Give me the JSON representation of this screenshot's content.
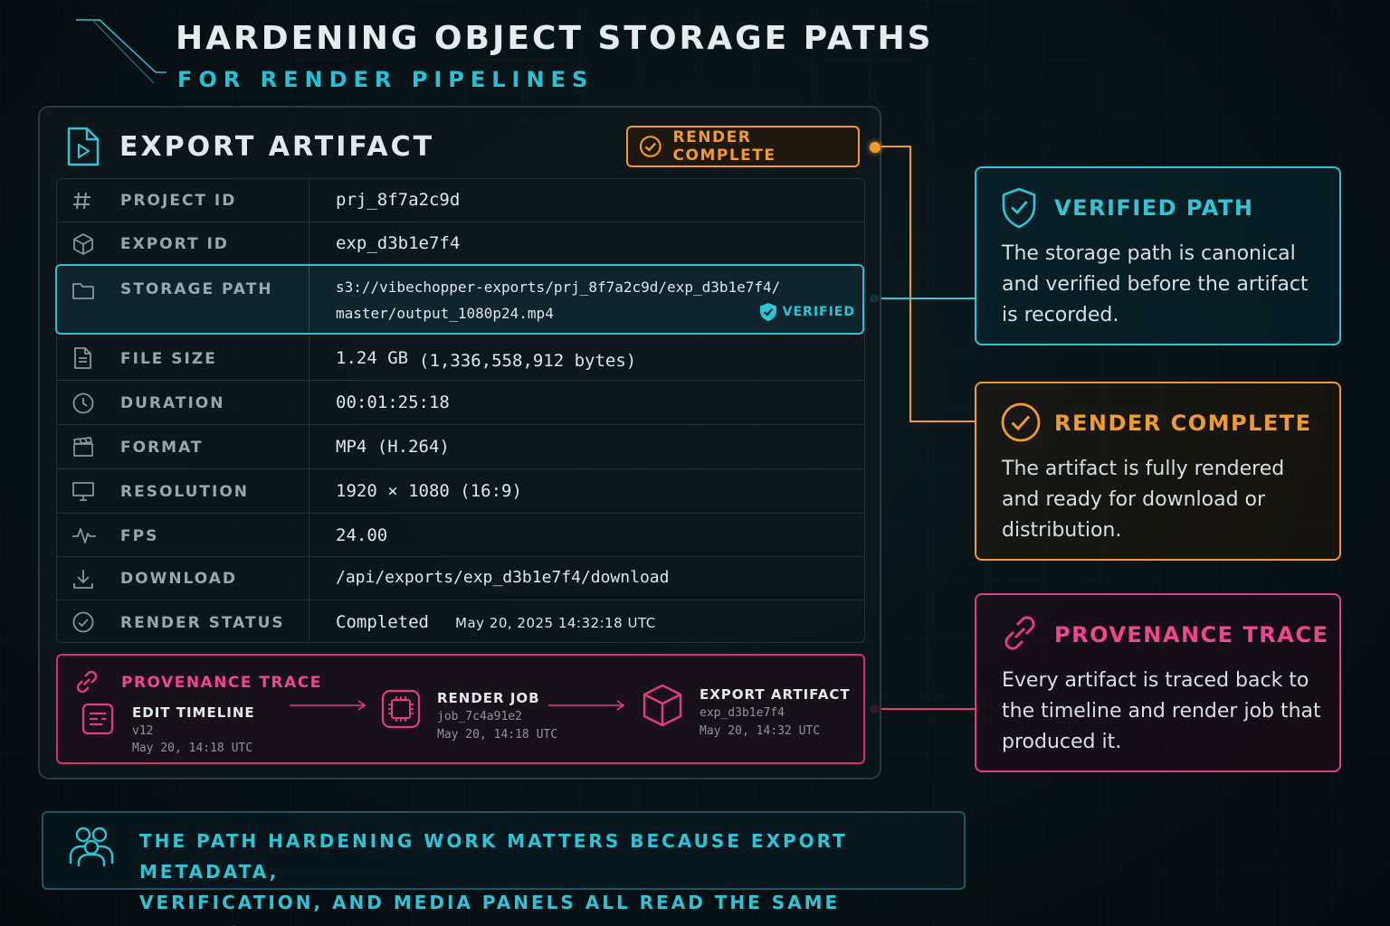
{
  "header": {
    "title": "HARDENING OBJECT STORAGE PATHS",
    "subtitle": "FOR RENDER PIPELINES"
  },
  "panel": {
    "title": "EXPORT ARTIFACT",
    "title_icon": "file-play-icon",
    "status_badge": "RENDER COMPLETE",
    "rows": [
      {
        "icon": "hash-icon",
        "label": "PROJECT ID",
        "value": "prj_8f7a2c9d"
      },
      {
        "icon": "cube-icon",
        "label": "EXPORT ID",
        "value": "exp_d3b1e7f4"
      },
      {
        "icon": "folder-icon",
        "label": "STORAGE PATH",
        "value_line1": "s3://vibechopper-exports/prj_8f7a2c9d/exp_d3b1e7f4/",
        "value_line2": "master/output_1080p24.mp4",
        "tag": "VERIFIED"
      },
      {
        "icon": "file-icon",
        "label": "FILE SIZE",
        "value": "1.24 GB",
        "detail": "(1,336,558,912 bytes)"
      },
      {
        "icon": "clock-icon",
        "label": "DURATION",
        "value": "00:01:25:18"
      },
      {
        "icon": "clapperboard-icon",
        "label": "FORMAT",
        "value": "MP4 (H.264)"
      },
      {
        "icon": "monitor-icon",
        "label": "RESOLUTION",
        "value": "1920 × 1080 (16:9)"
      },
      {
        "icon": "pulse-icon",
        "label": "FPS",
        "value": "24.00"
      },
      {
        "icon": "download-icon",
        "label": "DOWNLOAD",
        "value": "/api/exports/exp_d3b1e7f4/download"
      },
      {
        "icon": "check-circle-icon",
        "label": "RENDER STATUS",
        "value": "Completed",
        "detail": "May 20, 2025 14:32:18 UTC"
      }
    ],
    "provenance": {
      "title": "PROVENANCE TRACE",
      "steps": [
        {
          "title": "EDIT TIMELINE",
          "line1": "v12",
          "line2": "May 20, 14:18 UTC"
        },
        {
          "title": "RENDER JOB",
          "line1": "job_7c4a91e2",
          "line2": "May 20, 14:18 UTC"
        },
        {
          "title": "EXPORT ARTIFACT",
          "line1": "exp_d3b1e7f4",
          "line2": "May 20, 14:32 UTC"
        }
      ]
    }
  },
  "cards": [
    {
      "title": "VERIFIED PATH",
      "body": "The storage path is canonical and verified before the artifact is recorded.",
      "color": "#2fc4d6"
    },
    {
      "title": "RENDER COMPLETE",
      "body": "The artifact is fully rendered and ready for download or distribution.",
      "color": "#f29a2a"
    },
    {
      "title": "PROVENANCE TRACE",
      "body": "Every artifact is traced back to the timeline and render job that produced it.",
      "color": "#e23a84"
    }
  ],
  "footer": {
    "line1": "THE PATH HARDENING WORK MATTERS BECAUSE EXPORT METADATA,",
    "line2": "VERIFICATION, AND MEDIA PANELS ALL READ THE SAME ARTIFACT IDENTITY."
  },
  "colors": {
    "cyan": "#2fc4d6",
    "orange": "#f29a2a",
    "pink": "#e23a84",
    "green": "#3fd68b"
  }
}
